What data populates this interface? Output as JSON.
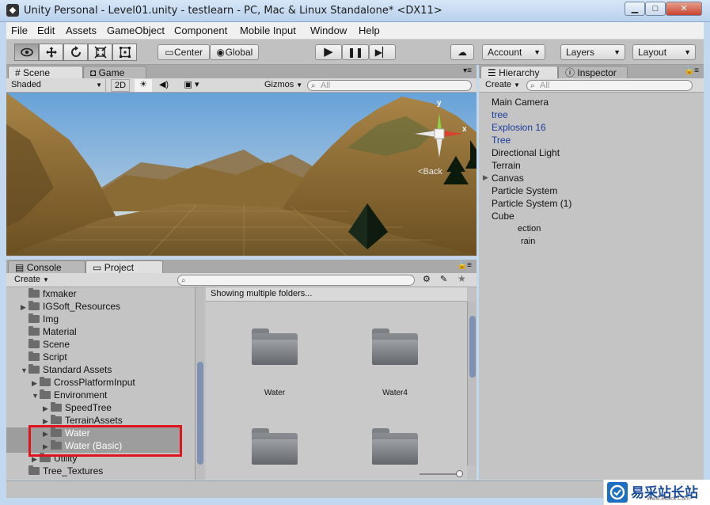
{
  "window": {
    "title": "Unity Personal - Level01.unity - testlearn - PC, Mac & Linux Standalone* <DX11>",
    "min_label": "▁",
    "max_label": "□",
    "close_label": "✕"
  },
  "menu": [
    "File",
    "Edit",
    "Assets",
    "GameObject",
    "Component",
    "Mobile Input",
    "Window",
    "Help"
  ],
  "toolbar": {
    "pivot_label": "Center",
    "space_label": "Global",
    "account_label": "Account",
    "layers_label": "Layers",
    "layout_label": "Layout"
  },
  "scene_panel": {
    "tab_scene": "Scene",
    "tab_game": "Game",
    "shading_mode": "Shaded",
    "mode_2d": "2D",
    "gizmos_label": "Gizmos",
    "search_placeholder": "All",
    "gizmo_y": "y",
    "gizmo_x": "x",
    "gizmo_back": "Back"
  },
  "hierarchy_panel": {
    "tab_hierarchy": "Hierarchy",
    "tab_inspector": "Inspector",
    "create_label": "Create",
    "search_placeholder": "All",
    "items": [
      {
        "label": "Main Camera",
        "prefab": false
      },
      {
        "label": "tree",
        "prefab": true
      },
      {
        "label": "Explosion 16",
        "prefab": true
      },
      {
        "label": "Tree",
        "prefab": true
      },
      {
        "label": "Directional Light",
        "prefab": false
      },
      {
        "label": "Terrain",
        "prefab": false
      },
      {
        "label": "Canvas",
        "prefab": false
      },
      {
        "label": "Particle System",
        "prefab": false
      },
      {
        "label": "Particle System (1)",
        "prefab": false
      },
      {
        "label": "Cube",
        "prefab": false
      }
    ],
    "partial_items": [
      "ection",
      "rain"
    ]
  },
  "project_panel": {
    "tab_console": "Console",
    "tab_project": "Project",
    "create_label": "Create",
    "tree": [
      {
        "label": "fxmaker",
        "indent": 0,
        "arrow": ""
      },
      {
        "label": "IGSoft_Resources",
        "indent": 0,
        "arrow": "▶"
      },
      {
        "label": "Img",
        "indent": 0,
        "arrow": ""
      },
      {
        "label": "Material",
        "indent": 0,
        "arrow": ""
      },
      {
        "label": "Scene",
        "indent": 0,
        "arrow": ""
      },
      {
        "label": "Script",
        "indent": 0,
        "arrow": ""
      },
      {
        "label": "Standard Assets",
        "indent": 0,
        "arrow": "▼"
      },
      {
        "label": "CrossPlatformInput",
        "indent": 1,
        "arrow": "▶"
      },
      {
        "label": "Environment",
        "indent": 1,
        "arrow": "▼"
      },
      {
        "label": "SpeedTree",
        "indent": 2,
        "arrow": "▶"
      },
      {
        "label": "TerrainAssets",
        "indent": 2,
        "arrow": "▶"
      },
      {
        "label": "Water",
        "indent": 2,
        "arrow": "▶"
      },
      {
        "label": "Water (Basic)",
        "indent": 2,
        "arrow": "▶"
      },
      {
        "label": "Utility",
        "indent": 1,
        "arrow": "▶"
      },
      {
        "label": "Tree_Textures",
        "indent": 0,
        "arrow": ""
      }
    ],
    "grid_header": "Showing multiple folders...",
    "grid_items": [
      {
        "label": "Water"
      },
      {
        "label": "Water4"
      },
      {
        "label": ""
      },
      {
        "label": ""
      }
    ]
  },
  "watermark": {
    "brand": "易采站长站",
    "sub": "Www.Easck.Com"
  },
  "colors": {
    "highlight_box": "#e0141c",
    "prefab_text": "#1d3b9a"
  }
}
